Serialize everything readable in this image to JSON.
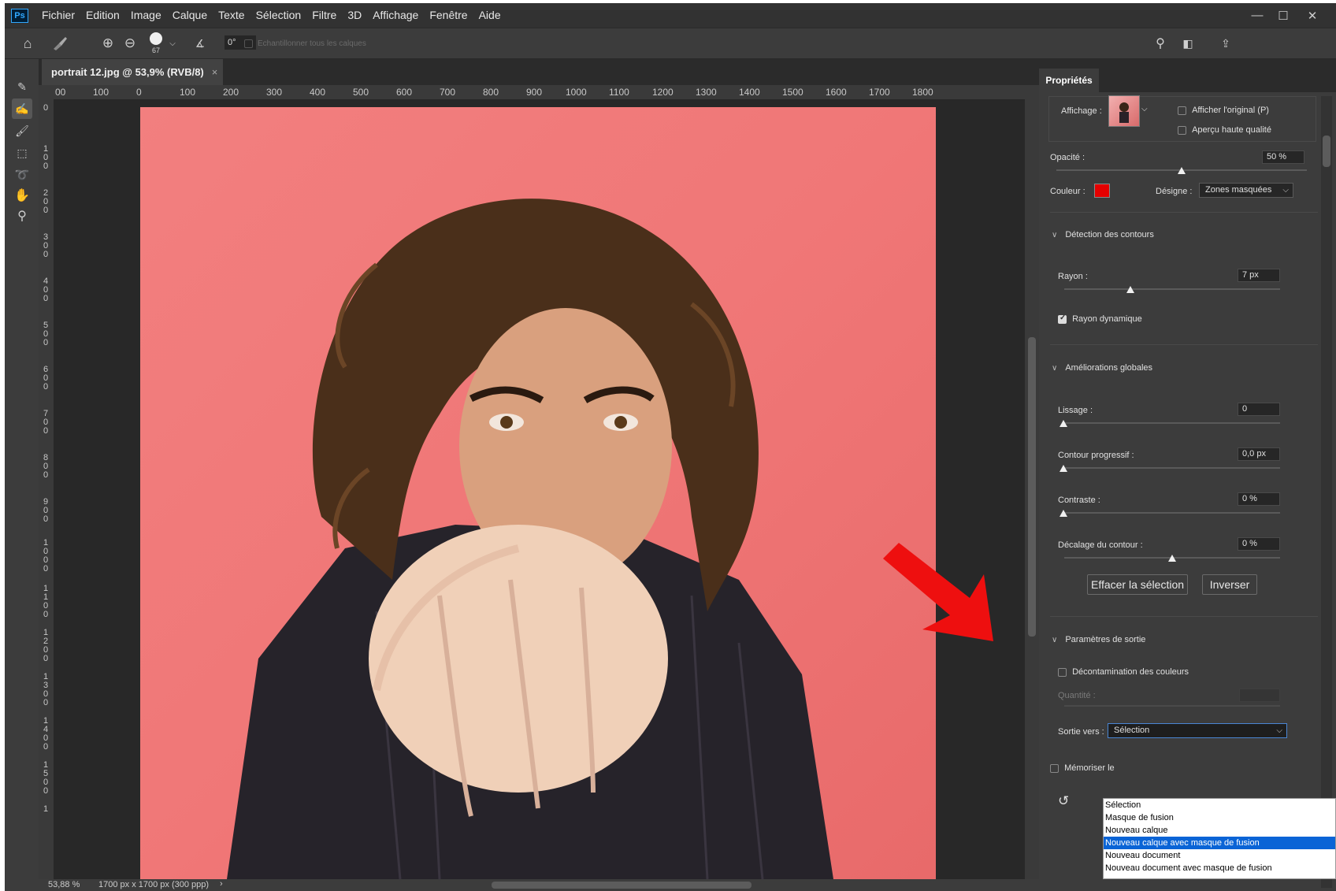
{
  "app": {
    "logo": "Ps"
  },
  "menu": [
    "Fichier",
    "Edition",
    "Image",
    "Calque",
    "Texte",
    "Sélection",
    "Filtre",
    "3D",
    "Affichage",
    "Fenêtre",
    "Aide"
  ],
  "window_controls": {
    "minimize": "—",
    "maximize": "☐",
    "close": "✕"
  },
  "options_bar": {
    "brush_size": "67",
    "angle": "0°",
    "sample_all_label": "Echantillonner tous les calques",
    "sample_all_checked": false
  },
  "document": {
    "tab_title": "portrait 12.jpg @ 53,9% (RVB/8)",
    "ruler_h": [
      "00",
      "100",
      "0",
      "100",
      "200",
      "300",
      "400",
      "500",
      "600",
      "700",
      "800",
      "900",
      "1000",
      "1100",
      "1200",
      "1300",
      "1400",
      "1500",
      "1600",
      "1700",
      "1800"
    ],
    "ruler_v": [
      "0",
      "100",
      "200",
      "300",
      "400",
      "500",
      "600",
      "700",
      "800",
      "900",
      "1000",
      "1100",
      "1200",
      "1300",
      "1400",
      "1500",
      "1"
    ],
    "status_zoom": "53,88 %",
    "status_size": "1700 px x 1700 px (300 ppp)"
  },
  "panel": {
    "tab": "Propriétés",
    "affichage_label": "Affichage :",
    "show_original": "Afficher l'original (P)",
    "high_quality": "Aperçu haute qualité",
    "opacity_label": "Opacité :",
    "opacity_value": "50 %",
    "opacity_level": 0.5,
    "color_label": "Couleur :",
    "color_value": "#e50000",
    "designate_label": "Désigne :",
    "designate_value": "Zones masquées",
    "edge_section": "Détection des contours",
    "radius_label": "Rayon :",
    "radius_value": "7 px",
    "smart_radius": "Rayon dynamique",
    "smart_radius_checked": true,
    "global_section": "Améliorations globales",
    "smooth_label": "Lissage :",
    "smooth_value": "0",
    "feather_label": "Contour progressif :",
    "feather_value": "0,0 px",
    "contrast_label": "Contraste :",
    "contrast_value": "0 %",
    "shift_label": "Décalage du contour :",
    "shift_value": "0 %",
    "clear_button": "Effacer la sélection",
    "invert_button": "Inverser",
    "output_section": "Paramètres de sortie",
    "decontaminate": "Décontamination des couleurs",
    "decontaminate_checked": false,
    "amount_label": "Quantité :",
    "output_to_label": "Sortie vers :",
    "output_to_value": "Sélection",
    "remember_label": "Mémoriser le",
    "output_options": [
      "Sélection",
      "Masque de fusion",
      "Nouveau calque",
      "Nouveau calque avec masque de fusion",
      "Nouveau document",
      "Nouveau document avec masque de fusion"
    ],
    "output_highlighted": "Nouveau calque avec masque de fusion"
  },
  "colors": {
    "arrow": "#ee0f0f",
    "photo_bg": "#f07777",
    "highlight": "#0a64d6"
  }
}
